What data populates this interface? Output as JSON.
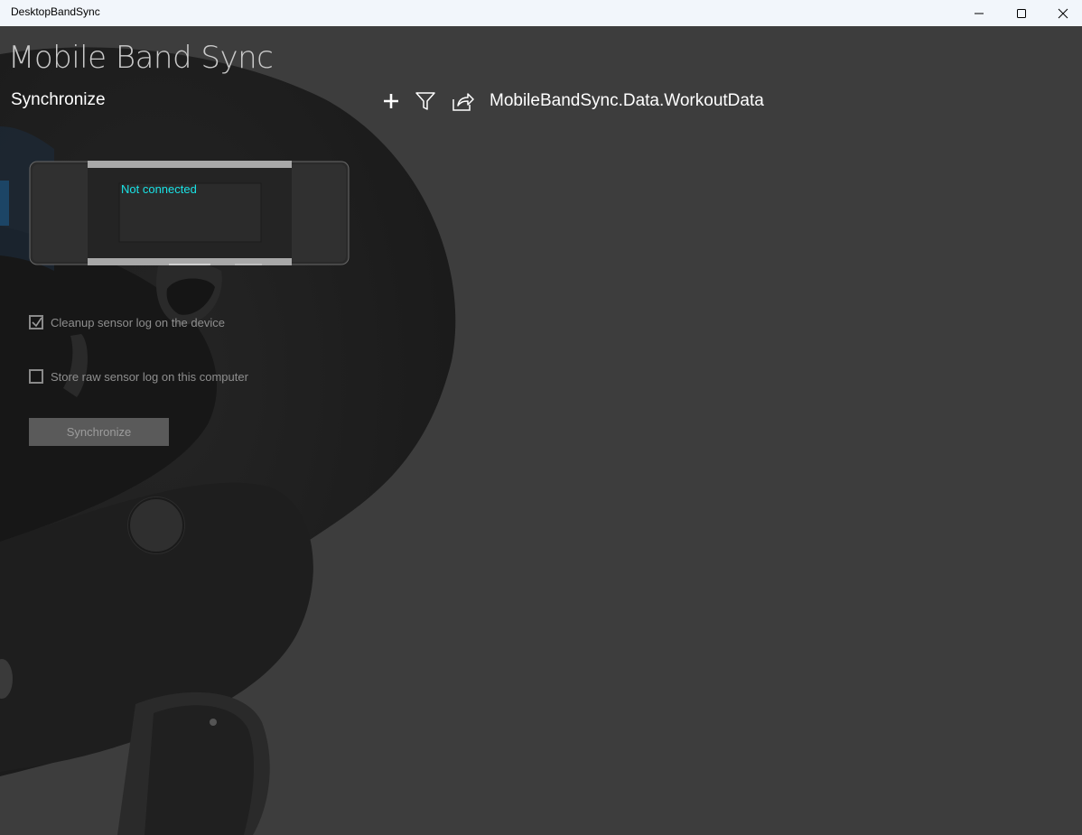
{
  "window": {
    "title": "DesktopBandSync"
  },
  "app": {
    "title": "Mobile Band Sync"
  },
  "sync_panel": {
    "title": "Synchronize",
    "device_status": "Not connected",
    "cleanup_option": {
      "label": "Cleanup sensor log on the device",
      "checked": true
    },
    "store_raw_option": {
      "label": "Store raw sensor log on this computer",
      "checked": false
    },
    "sync_button": {
      "label": "Synchronize",
      "enabled": false
    }
  },
  "data_panel": {
    "title": "MobileBandSync.Data.WorkoutData",
    "toolbar": [
      "add-icon",
      "filter-icon",
      "share-icon"
    ]
  },
  "colors": {
    "status_accent": "#19e3e6",
    "background": "#3d3d3d",
    "titlebar": "#f2f6fb"
  }
}
